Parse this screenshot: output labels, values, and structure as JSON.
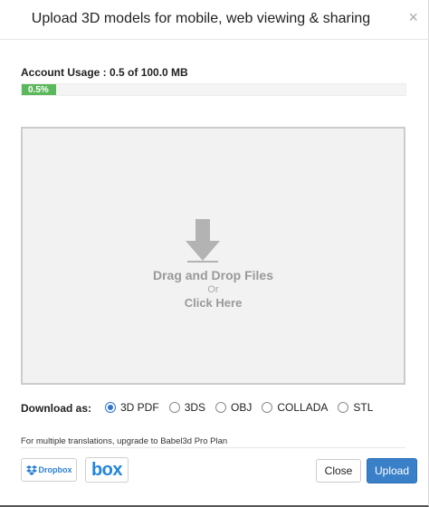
{
  "dialog": {
    "title": "Upload 3D models for mobile, web viewing & sharing",
    "close_glyph": "×"
  },
  "usage": {
    "label": "Account Usage : 0.5 of 100.0 MB",
    "percent_text": "0.5%",
    "percent": 9
  },
  "dropzone": {
    "main_text": "Drag and Drop Files",
    "or_text": "Or",
    "click_text": "Click Here",
    "icon": "download-arrow-icon"
  },
  "download": {
    "label": "Download as:",
    "selected": "3D PDF",
    "formats": [
      "3D PDF",
      "3DS",
      "OBJ",
      "COLLADA",
      "STL"
    ]
  },
  "note": {
    "text": "For multiple translations, upgrade to Babel3d Pro Plan"
  },
  "cloud": {
    "dropbox_label": "Dropbox",
    "box_label": "box"
  },
  "buttons": {
    "close_label": "Close",
    "upload_label": "Upload"
  },
  "colors": {
    "progress": "#5cb85c",
    "primary": "#3a80c9",
    "dropbox": "#2d7fd4",
    "box": "#2486d8"
  }
}
